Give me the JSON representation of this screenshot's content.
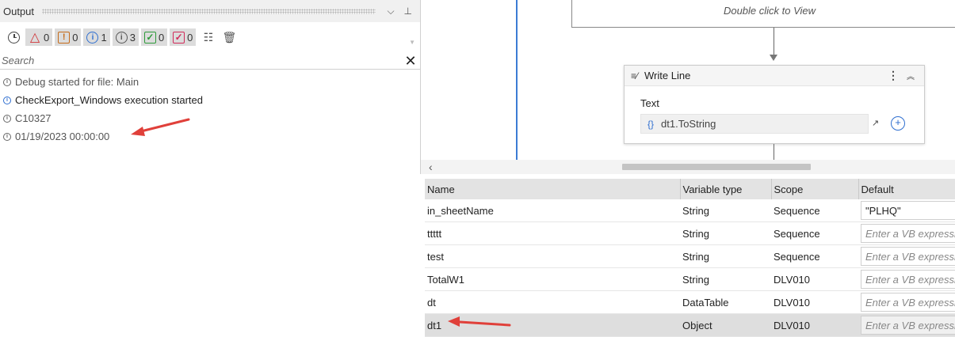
{
  "output": {
    "title": "Output",
    "header_buttons": {
      "dropdown": "⌵",
      "pin": "⊥"
    },
    "toolbar": {
      "errors": "0",
      "warnings": "0",
      "info": "1",
      "trace": "3",
      "verbose": "0",
      "critical": "0"
    },
    "search": {
      "placeholder": "Search",
      "clear": "✕"
    },
    "log": [
      {
        "type": "trace",
        "text": "Debug started for file: Main"
      },
      {
        "type": "info",
        "text": "CheckExport_Windows execution started"
      },
      {
        "type": "trace",
        "text": "C10327"
      },
      {
        "type": "trace",
        "text": "01/19/2023 00:00:00"
      }
    ]
  },
  "designer": {
    "top_activity_hint": "Double click to View",
    "write_line": {
      "title": "Write Line",
      "field_label": "Text",
      "field_value": "dt1.ToString",
      "braces": "{}"
    }
  },
  "variables": {
    "headers": [
      "Name",
      "Variable type",
      "Scope",
      "Default"
    ],
    "rows": [
      {
        "name": "in_sheetName",
        "type": "String",
        "scope": "Sequence",
        "default": "\"PLHQ\"",
        "placeholder": false
      },
      {
        "name": "ttttt",
        "type": "String",
        "scope": "Sequence",
        "default": "Enter a VB expression",
        "placeholder": true
      },
      {
        "name": "test",
        "type": "String",
        "scope": "Sequence",
        "default": "Enter a VB expression",
        "placeholder": true
      },
      {
        "name": "TotalW1",
        "type": "String",
        "scope": "DLV010",
        "default": "Enter a VB expression",
        "placeholder": true
      },
      {
        "name": "dt",
        "type": "DataTable",
        "scope": "DLV010",
        "default": "Enter a VB expression",
        "placeholder": true
      },
      {
        "name": "dt1",
        "type": "Object",
        "scope": "DLV010",
        "default": "Enter a VB expression",
        "placeholder": true,
        "selected": true
      }
    ]
  },
  "colors": {
    "annotation_arrow": "#e0403a",
    "sequence_line": "#3c7bd4",
    "info_blue": "#2f6fd0"
  }
}
